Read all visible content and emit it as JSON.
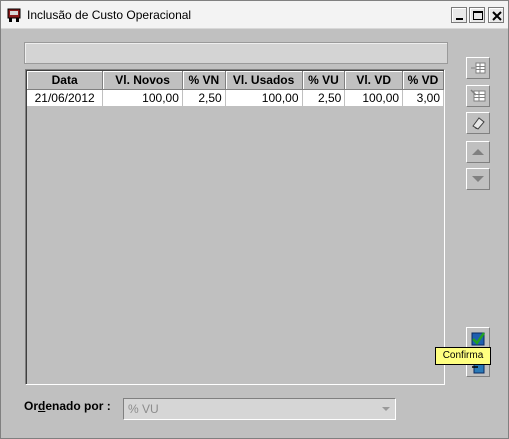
{
  "window": {
    "title": "Inclusão de Custo Operacional"
  },
  "grid": {
    "columns": [
      "Data",
      "Vl. Novos",
      "% VN",
      "Vl. Usados",
      "% VU",
      "Vl. VD",
      "% VD"
    ],
    "rows": [
      [
        "21/06/2012",
        "100,00",
        "2,50",
        "100,00",
        "2,50",
        "100,00",
        "3,00"
      ]
    ]
  },
  "toolbar": {
    "buttons": [
      "insert-row-icon",
      "edit-row-icon",
      "clear-icon",
      "move-up-icon",
      "move-down-icon",
      "confirm-icon",
      "cancel-icon"
    ]
  },
  "tooltip": {
    "text": "Confirma"
  },
  "order": {
    "label_prefix": "Or",
    "label_underlined": "d",
    "label_suffix": "enado por :",
    "selected": "% VU"
  }
}
